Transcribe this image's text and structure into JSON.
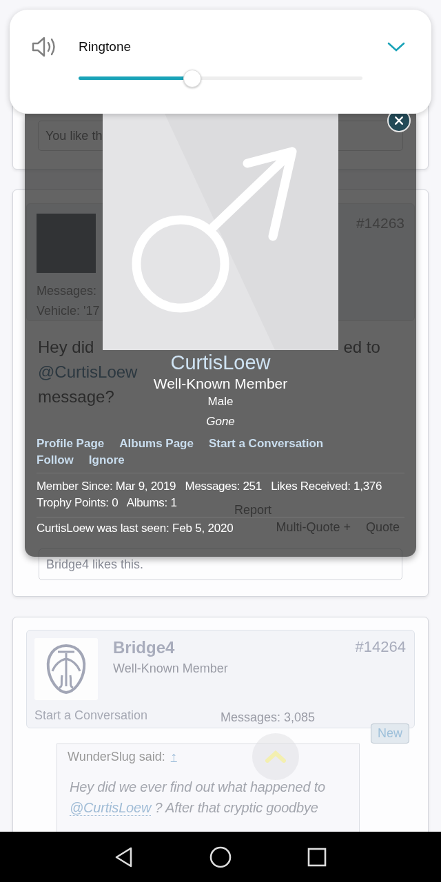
{
  "volume_panel": {
    "label": "Ringtone",
    "level": 0.4
  },
  "card_top": {
    "like_field": "You like th"
  },
  "post_1": {
    "number": "#14263",
    "stats": [
      "Messages:",
      "Vehicle:  '17"
    ],
    "message_fragments": [
      "Hey did",
      "ed to"
    ],
    "mention": "@CurtisLoew",
    "message_end": "message?",
    "actions": [
      "Report",
      "Multi-Quote +",
      "Quote"
    ],
    "likes": "Bridge4 likes this."
  },
  "profile_popup": {
    "name": "CurtisLoew",
    "title": "Well-Known Member",
    "gender": "Male",
    "status": "Gone",
    "links": [
      "Profile Page",
      "Albums Page",
      "Start a Conversation",
      "Follow",
      "Ignore"
    ],
    "stats": "Member Since: Mar 9, 2019   Messages: 251   Likes Received: 1,376   Trophy Points: 0   Albums: 1",
    "last_seen": "CurtisLoew was last seen: Feb 5, 2020"
  },
  "post_2": {
    "author": "Bridge4",
    "title": "Well-Known Member",
    "number": "#14264",
    "start_conversation": "Start a Conversation",
    "messages": "Messages:  3,085",
    "badge": "New",
    "quote": {
      "author": "WunderSlug said:",
      "jump": "↑",
      "text_before": "Hey did we ever find out what happened to",
      "mention": "@CurtisLoew",
      "text_after": "? After that cryptic goodbye"
    }
  }
}
